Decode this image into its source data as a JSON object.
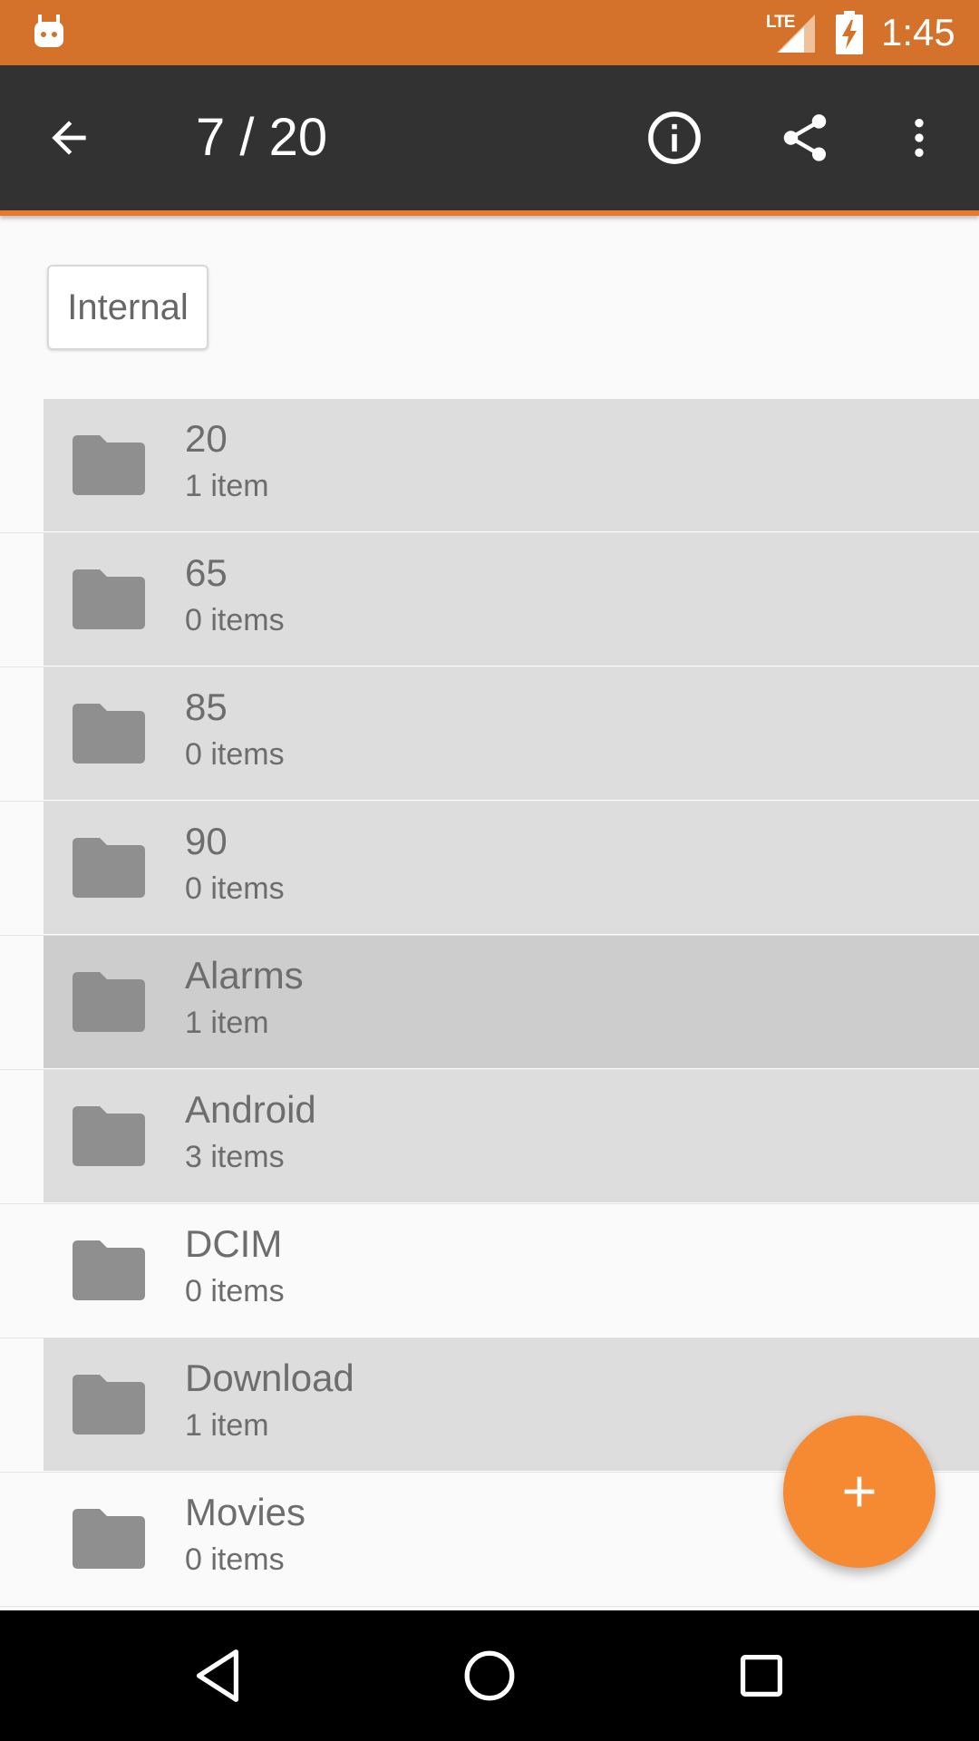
{
  "status_bar": {
    "network": "LTE",
    "time": "1:45"
  },
  "toolbar": {
    "title": "7 / 20",
    "icons": [
      "back-arrow-icon",
      "info-icon",
      "share-icon",
      "more-vert-icon"
    ]
  },
  "breadcrumb": {
    "label": "Internal"
  },
  "files": [
    {
      "name": "20",
      "count": "1 item",
      "state": "selected"
    },
    {
      "name": "65",
      "count": "0 items",
      "state": "selected"
    },
    {
      "name": "85",
      "count": "0 items",
      "state": "selected"
    },
    {
      "name": "90",
      "count": "0 items",
      "state": "selected"
    },
    {
      "name": "Alarms",
      "count": "1 item",
      "state": "focused"
    },
    {
      "name": "Android",
      "count": "3 items",
      "state": "selected"
    },
    {
      "name": "DCIM",
      "count": "0 items",
      "state": "normal"
    },
    {
      "name": "Download",
      "count": "1 item",
      "state": "selected"
    },
    {
      "name": "Movies",
      "count": "0 items",
      "state": "normal"
    }
  ],
  "fab": {
    "icon": "add-icon",
    "color": "#f58a33"
  },
  "colors": {
    "status_bar": "#d4722b",
    "toolbar": "#323232",
    "accent": "#e8792e",
    "selected_row": "#dddddd",
    "focused_row": "#cdcdcd"
  }
}
